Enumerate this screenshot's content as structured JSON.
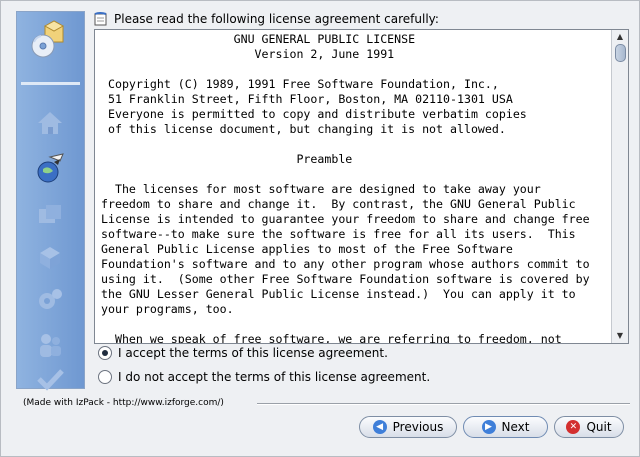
{
  "header": {
    "instruction": "Please read the following license agreement carefully:"
  },
  "license_text": "                   GNU GENERAL PUBLIC LICENSE\n                      Version 2, June 1991\n\n Copyright (C) 1989, 1991 Free Software Foundation, Inc.,\n 51 Franklin Street, Fifth Floor, Boston, MA 02110-1301 USA\n Everyone is permitted to copy and distribute verbatim copies\n of this license document, but changing it is not allowed.\n\n                            Preamble\n\n  The licenses for most software are designed to take away your\nfreedom to share and change it.  By contrast, the GNU General Public\nLicense is intended to guarantee your freedom to share and change free\nsoftware--to make sure the software is free for all its users.  This\nGeneral Public License applies to most of the Free Software\nFoundation's software and to any other program whose authors commit to\nusing it.  (Some other Free Software Foundation software is covered by\nthe GNU Lesser General Public License instead.)  You can apply it to\nyour programs, too.\n\n  When we speak of free software, we are referring to freedom, not",
  "options": {
    "accept": "I accept the terms of this license agreement.",
    "decline": "I do not accept the terms of this license agreement.",
    "selected": "accept"
  },
  "footer": {
    "made_with": "(Made with IzPack - http://www.izforge.com/)"
  },
  "buttons": {
    "previous": "Previous",
    "next": "Next",
    "quit": "Quit"
  },
  "steps_icons": [
    "installer-icon",
    "home-icon",
    "license-icon",
    "packs-icon",
    "install-icon",
    "settings-icon",
    "users-icon",
    "finish-icon"
  ],
  "colors": {
    "panel": "#7aa1d6",
    "accent": "#1f5fbf",
    "quit": "#d32f2f"
  }
}
